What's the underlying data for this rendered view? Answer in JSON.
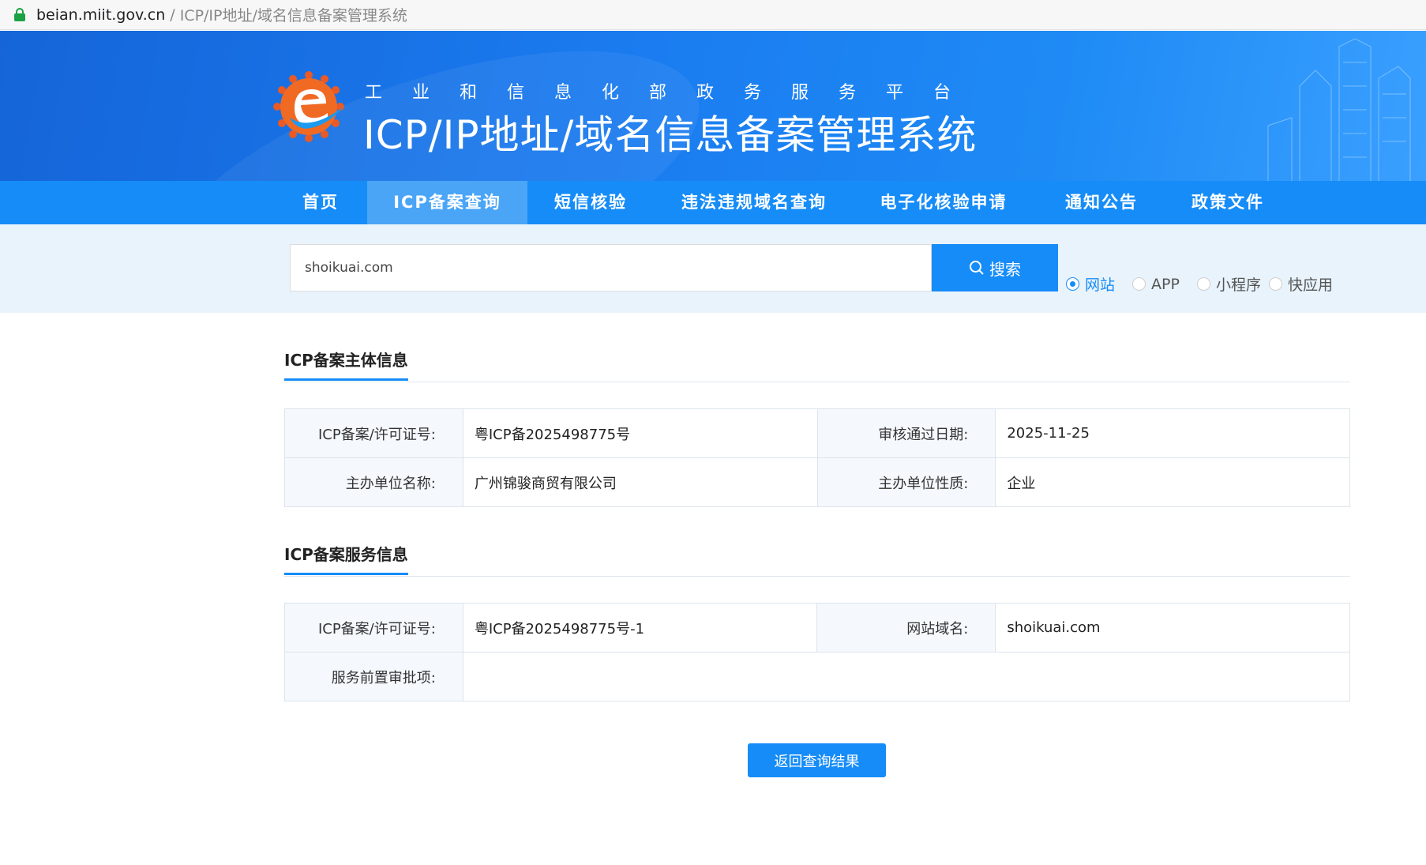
{
  "browser": {
    "host": "beian.miit.gov.cn",
    "separator": "/",
    "path": "ICP/IP地址/域名信息备案管理系统"
  },
  "banner": {
    "subtitle": "工业和信息化部政务服务平台",
    "title": "ICP/IP地址/域名信息备案管理系统"
  },
  "nav": {
    "items": [
      {
        "label": "首页"
      },
      {
        "label": "ICP备案查询"
      },
      {
        "label": "短信核验"
      },
      {
        "label": "违法违规域名查询"
      },
      {
        "label": "电子化核验申请"
      },
      {
        "label": "通知公告"
      },
      {
        "label": "政策文件"
      }
    ],
    "active_index": 1
  },
  "search": {
    "value": "shoikuai.com",
    "button_label": "搜索",
    "options": [
      "网站",
      "APP",
      "小程序",
      "快应用"
    ],
    "selected": "网站"
  },
  "colors": {
    "primary": "#168cf8",
    "nav_active": "#4aa5f7",
    "search_band": "#e9f3fc"
  },
  "subject_info": {
    "title": "ICP备案主体信息",
    "rows": [
      {
        "label1": "ICP备案/许可证号:",
        "value1": "粤ICP备2025498775号",
        "label2": "审核通过日期:",
        "value2": "2025-11-25"
      },
      {
        "label1": "主办单位名称:",
        "value1": "广州锦骏商贸有限公司",
        "label2": "主办单位性质:",
        "value2": "企业"
      }
    ]
  },
  "service_info": {
    "title": "ICP备案服务信息",
    "row1": {
      "label1": "ICP备案/许可证号:",
      "value1": "粤ICP备2025498775号-1",
      "label2": "网站域名:",
      "value2": "shoikuai.com"
    },
    "row2": {
      "label1": "服务前置审批项:",
      "value1": ""
    }
  },
  "back_button_label": "返回查询结果"
}
